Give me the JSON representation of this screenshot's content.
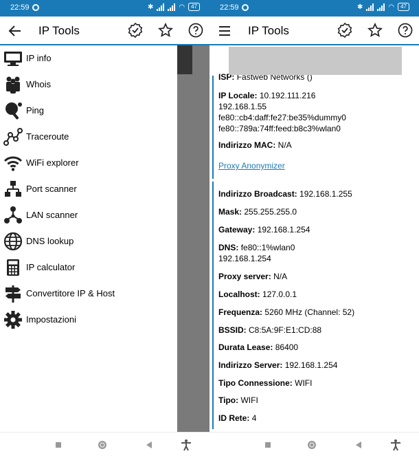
{
  "status": {
    "time": "22:59",
    "battery": "47"
  },
  "app": {
    "title": "IP Tools"
  },
  "drawer": {
    "items": [
      {
        "label": "IP info",
        "icon": "monitor-icon"
      },
      {
        "label": "Whois",
        "icon": "people-icon"
      },
      {
        "label": "Ping",
        "icon": "ping-pong-icon"
      },
      {
        "label": "Traceroute",
        "icon": "route-icon"
      },
      {
        "label": "WiFi explorer",
        "icon": "wifi-icon"
      },
      {
        "label": "Port scanner",
        "icon": "network-tree-icon"
      },
      {
        "label": "LAN scanner",
        "icon": "lan-icon"
      },
      {
        "label": "DNS lookup",
        "icon": "globe-icon"
      },
      {
        "label": "IP calculator",
        "icon": "calculator-icon"
      },
      {
        "label": "Convertitore IP & Host",
        "icon": "signpost-icon"
      },
      {
        "label": "Impostazioni",
        "icon": "gear-icon"
      }
    ]
  },
  "info": {
    "isp": {
      "label": "ISP:",
      "value": "Fastweb Networks ()"
    },
    "ip_locale": {
      "label": "IP Locale:",
      "value": "10.192.111.216",
      "extra": [
        "192.168.1.55",
        "fe80::cb4:daff:fe27:be35%dummy0",
        "fe80::789a:74ff:feed:b8c3%wlan0"
      ]
    },
    "mac": {
      "label": "Indirizzo MAC:",
      "value": "N/A"
    },
    "proxy_link": "Proxy Anonymizer",
    "rows": [
      {
        "label": "Indirizzo Broadcast:",
        "value": "192.168.1.255"
      },
      {
        "label": "Mask:",
        "value": "255.255.255.0"
      },
      {
        "label": "Gateway:",
        "value": "192.168.1.254"
      },
      {
        "label": "DNS:",
        "value": "fe80::1%wlan0",
        "extra": "192.168.1.254"
      },
      {
        "label": "Proxy server:",
        "value": "N/A"
      },
      {
        "label": "Localhost:",
        "value": "127.0.0.1"
      },
      {
        "label": "Frequenza:",
        "value": "5260 MHz (Channel: 52)"
      },
      {
        "label": "BSSID:",
        "value": "C8:5A:9F:E1:CD:88"
      },
      {
        "label": "Durata Lease:",
        "value": "86400"
      },
      {
        "label": "Indirizzo Server:",
        "value": "192.168.1.254"
      },
      {
        "label": "Tipo Connessione:",
        "value": "WIFI"
      },
      {
        "label": "Tipo:",
        "value": "WIFI"
      },
      {
        "label": "ID Rete:",
        "value": "4"
      }
    ]
  },
  "colors": {
    "accent": "#1a7ab8",
    "scrim": "#7a7a7a"
  }
}
